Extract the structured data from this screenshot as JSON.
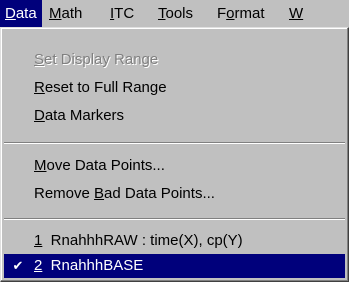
{
  "menubar": {
    "items": [
      {
        "pre": "",
        "mnem": "D",
        "post": "ata"
      },
      {
        "pre": "",
        "mnem": "M",
        "post": "ath"
      },
      {
        "pre": "",
        "mnem": "I",
        "post": "TC"
      },
      {
        "pre": "",
        "mnem": "T",
        "post": "ools"
      },
      {
        "pre": "F",
        "mnem": "o",
        "post": "rmat"
      },
      {
        "pre": "",
        "mnem": "W",
        "post": ""
      }
    ]
  },
  "data_menu": {
    "items": [
      {
        "pre": "",
        "mnem": "S",
        "post": "et Display Range",
        "enabled": false
      },
      {
        "pre": "",
        "mnem": "R",
        "post": "eset to Full Range",
        "enabled": true
      },
      {
        "pre": "",
        "mnem": "D",
        "post": "ata Markers",
        "enabled": true
      },
      {
        "pre": "",
        "mnem": "M",
        "post": "ove Data Points...",
        "enabled": true
      },
      {
        "pre": "Remove ",
        "mnem": "B",
        "post": "ad Data Points...",
        "enabled": true
      },
      {
        "pre": "",
        "mnem": "1",
        "post": "  RnahhhRAW : time(X), cp(Y)",
        "enabled": true,
        "checked": false
      },
      {
        "pre": "",
        "mnem": "2",
        "post": "  RnahhhBASE",
        "enabled": true,
        "checked": true,
        "selected": true
      }
    ],
    "check_glyph": "✔"
  }
}
